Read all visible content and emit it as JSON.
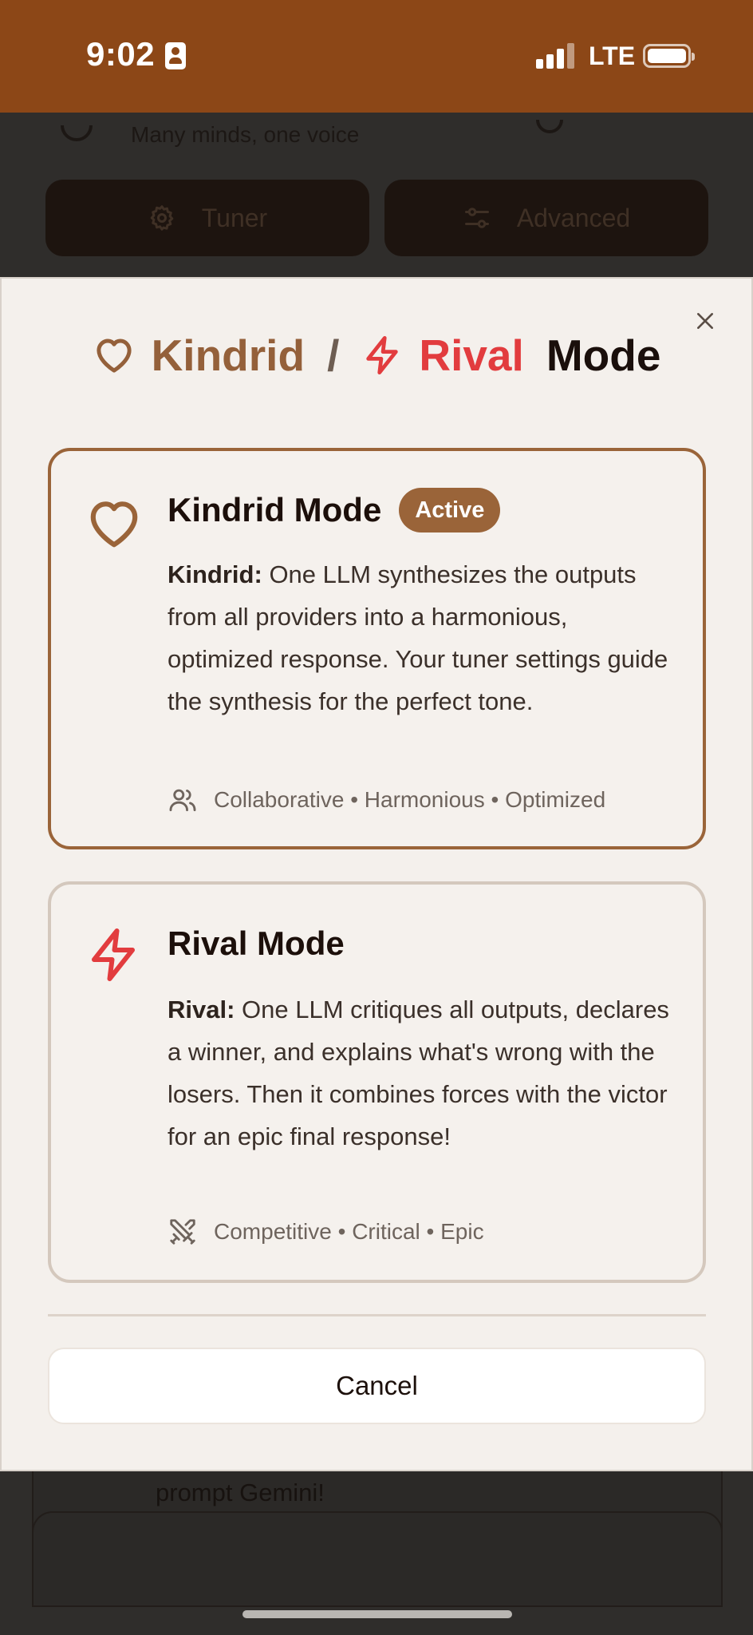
{
  "status_bar": {
    "time": "9:02",
    "network": "LTE"
  },
  "background_app": {
    "tagline": "Many minds, one voice",
    "tuner_label": "Tuner",
    "advanced_label": "Advanced",
    "card_text": "prompt Gemini!"
  },
  "modal": {
    "title_kindrid": "Kindrid",
    "title_separator": "/",
    "title_rival": "Rival",
    "title_mode": "Mode",
    "kindrid_card": {
      "title": "Kindrid Mode",
      "badge": "Active",
      "desc_label": "Kindrid:",
      "desc_text": "One LLM synthesizes the outputs from all providers into a harmonious, optimized response. Your tuner settings guide the synthesis for the perfect tone.",
      "tags": "Collaborative • Harmonious • Optimized"
    },
    "rival_card": {
      "title": "Rival Mode",
      "desc_label": "Rival:",
      "desc_text": "One LLM critiques all outputs, declares a winner, and explains what's wrong with the losers. Then it combines forces with the victor for an epic final response!",
      "tags": "Competitive • Critical • Epic"
    },
    "cancel_label": "Cancel"
  },
  "colors": {
    "status_bar": "#8c4717",
    "kindrid_accent": "#9a6439",
    "rival_accent": "#e23c3e",
    "modal_bg": "#f4f0ec"
  },
  "icons": [
    "heart-icon",
    "bolt-icon",
    "close-icon",
    "users-icon",
    "swords-icon",
    "gear-icon",
    "sliders-icon"
  ]
}
